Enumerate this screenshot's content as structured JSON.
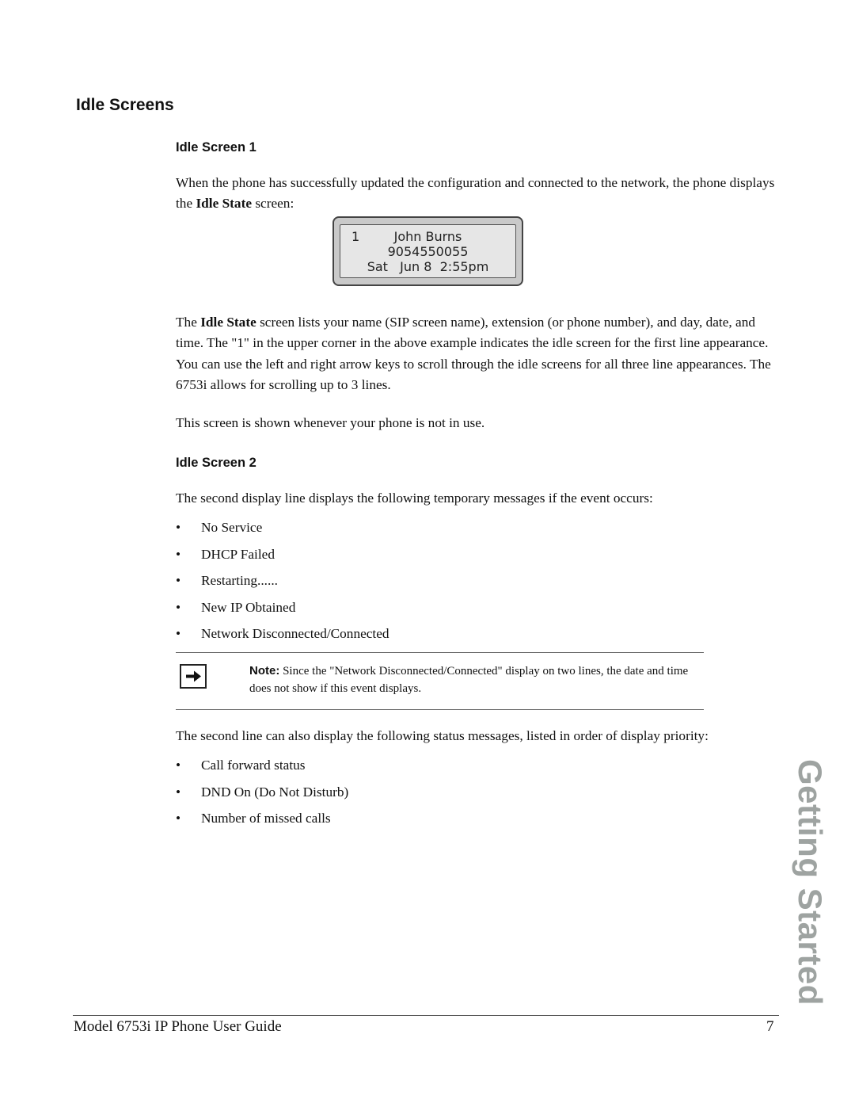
{
  "section": {
    "title": "Idle Screens"
  },
  "idle_screen_1": {
    "heading": "Idle Screen 1",
    "intro": {
      "before": "When the phone has successfully updated the configuration and connected to the network, the phone displays the ",
      "bold": "Idle State",
      "after": " screen:"
    },
    "lcd": {
      "line_number": "1",
      "name": "John Burns",
      "number": "9054550055",
      "datetime": "Sat   Jun 8  2:55pm"
    },
    "description": {
      "before": "The ",
      "bold": "Idle State",
      "after": " screen lists your name (SIP screen name), extension (or phone number), and day, date, and time. The \"1\" in the upper corner in the above example indicates the idle screen for the first line appearance. You can use the left and right arrow keys to scroll through the idle screens for all three line appearances. The 6753i allows for scrolling up to 3 lines."
    },
    "usage": "This screen is shown whenever your phone is not in use."
  },
  "idle_screen_2": {
    "heading": "Idle Screen 2",
    "intro": "The second display line displays the following temporary messages if the event occurs:",
    "temporary_messages": [
      "No Service",
      "DHCP Failed",
      "Restarting......",
      "New IP Obtained",
      "Network Disconnected/Connected"
    ],
    "note": {
      "icon": "arrow-right-icon",
      "label": "Note:",
      "text": " Since the \"Network Disconnected/Connected\" display on two lines, the date and time does not show if this event displays."
    },
    "status_intro": "The second line can also display the following status messages, listed in order of display priority:",
    "status_messages": [
      "Call forward status",
      "DND On (Do Not Disturb)",
      "Number of missed calls"
    ],
    "bullet_glyph": "•"
  },
  "side_tab": {
    "label": "Getting Started",
    "color": "#9ea3a1"
  },
  "footer": {
    "guide_title": "Model 6753i IP Phone User Guide",
    "page_number": "7"
  }
}
